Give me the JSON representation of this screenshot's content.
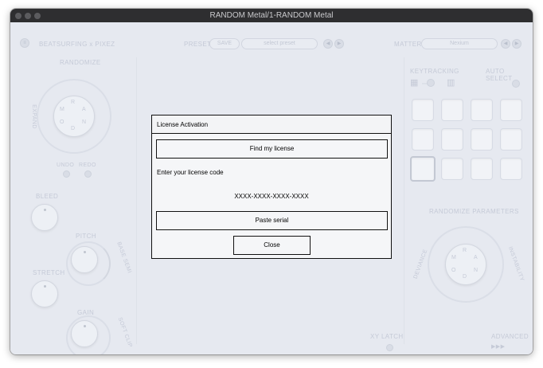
{
  "window": {
    "title": "RANDOM Metal/1-RANDOM Metal"
  },
  "header": {
    "brand": "BEATSURFING x PIXEZ",
    "preset_label": "PRESET",
    "save_label": "SAVE",
    "preset_value": "select preset",
    "matter_label": "MATTER",
    "matter_value": "Nexium"
  },
  "left_panel": {
    "randomize_label": "RANDOMIZE",
    "wheel_letters": [
      "R",
      "A",
      "N",
      "D",
      "O",
      "M"
    ],
    "side_label": "EXPAND",
    "undo_label": "UNDO",
    "redo_label": "REDO",
    "bleed_label": "BLEED",
    "pitch_label": "PITCH",
    "pitch_side_label": "BASE SEMI",
    "stretch_label": "STRETCH",
    "gain_label": "GAIN",
    "gain_side_label": "SOFT CLIP"
  },
  "right_panel": {
    "keytracking_label": "KEYTRACKING",
    "auto_select_label": "AUTO SELECT",
    "randomize_params_label": "RANDOMIZE PARAMETERS",
    "wheel_letters": [
      "R",
      "A",
      "N",
      "D",
      "O",
      "M"
    ],
    "left_arc_label": "DEVIANCE",
    "right_arc_label": "INSTABILITY",
    "advanced_label": "ADVANCED",
    "advanced_glyph": "▶▶▶"
  },
  "footer": {
    "xy_latch_label": "XY LATCH"
  },
  "dialog": {
    "title": "License Activation",
    "find_license_label": "Find my license",
    "enter_code_label": "Enter your license code",
    "license_code_placeholder": "XXXX-XXXX-XXXX-XXXX",
    "paste_serial_label": "Paste serial",
    "close_label": "Close"
  }
}
